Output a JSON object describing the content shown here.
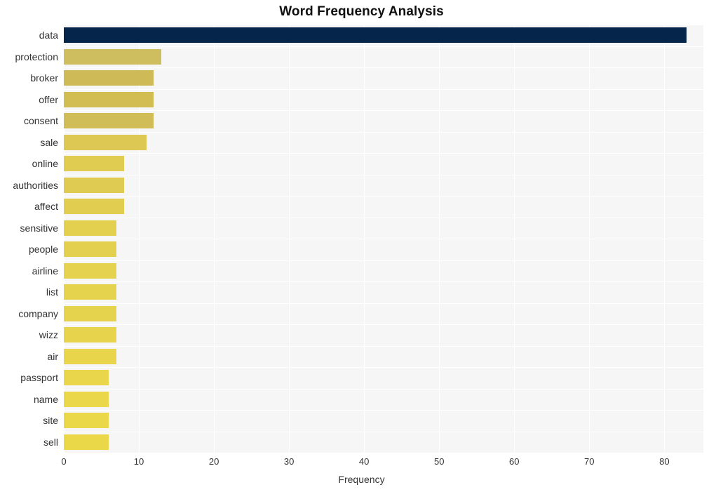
{
  "chart_data": {
    "type": "bar",
    "orientation": "horizontal",
    "title": "Word Frequency Analysis",
    "xlabel": "Frequency",
    "ylabel": "",
    "categories": [
      "data",
      "protection",
      "broker",
      "offer",
      "consent",
      "sale",
      "online",
      "authorities",
      "affect",
      "sensitive",
      "people",
      "airline",
      "list",
      "company",
      "wizz",
      "air",
      "passport",
      "name",
      "site",
      "sell"
    ],
    "values": [
      83,
      13,
      12,
      12,
      12,
      11,
      8,
      8,
      8,
      7,
      7,
      7,
      7,
      7,
      7,
      7,
      6,
      6,
      6,
      6
    ],
    "xlim": [
      0,
      85.2
    ],
    "xticks": [
      0,
      10,
      20,
      30,
      40,
      50,
      60,
      70,
      80
    ],
    "xtick_labels": [
      "0",
      "10",
      "20",
      "30",
      "40",
      "50",
      "60",
      "70",
      "80"
    ],
    "grid": true,
    "legend": false,
    "bar_colors": [
      "#06254b",
      "#cebe5f",
      "#ceba56",
      "#d2bd53",
      "#d0bd57",
      "#dcc852",
      "#e0cc50",
      "#dfcb51",
      "#e1cd50",
      "#e3d04f",
      "#e4d04f",
      "#e5d24e",
      "#e6d34d",
      "#e6d34d",
      "#e7d44c",
      "#e8d54b",
      "#e9d64a",
      "#ead74a",
      "#ead849",
      "#ebd848"
    ],
    "plot_background": "#f6f6f6",
    "gridline_color": "#ffffff",
    "page_background": "#ffffff",
    "accent_color": "#06254b",
    "highlight_color": "#ebd848"
  }
}
